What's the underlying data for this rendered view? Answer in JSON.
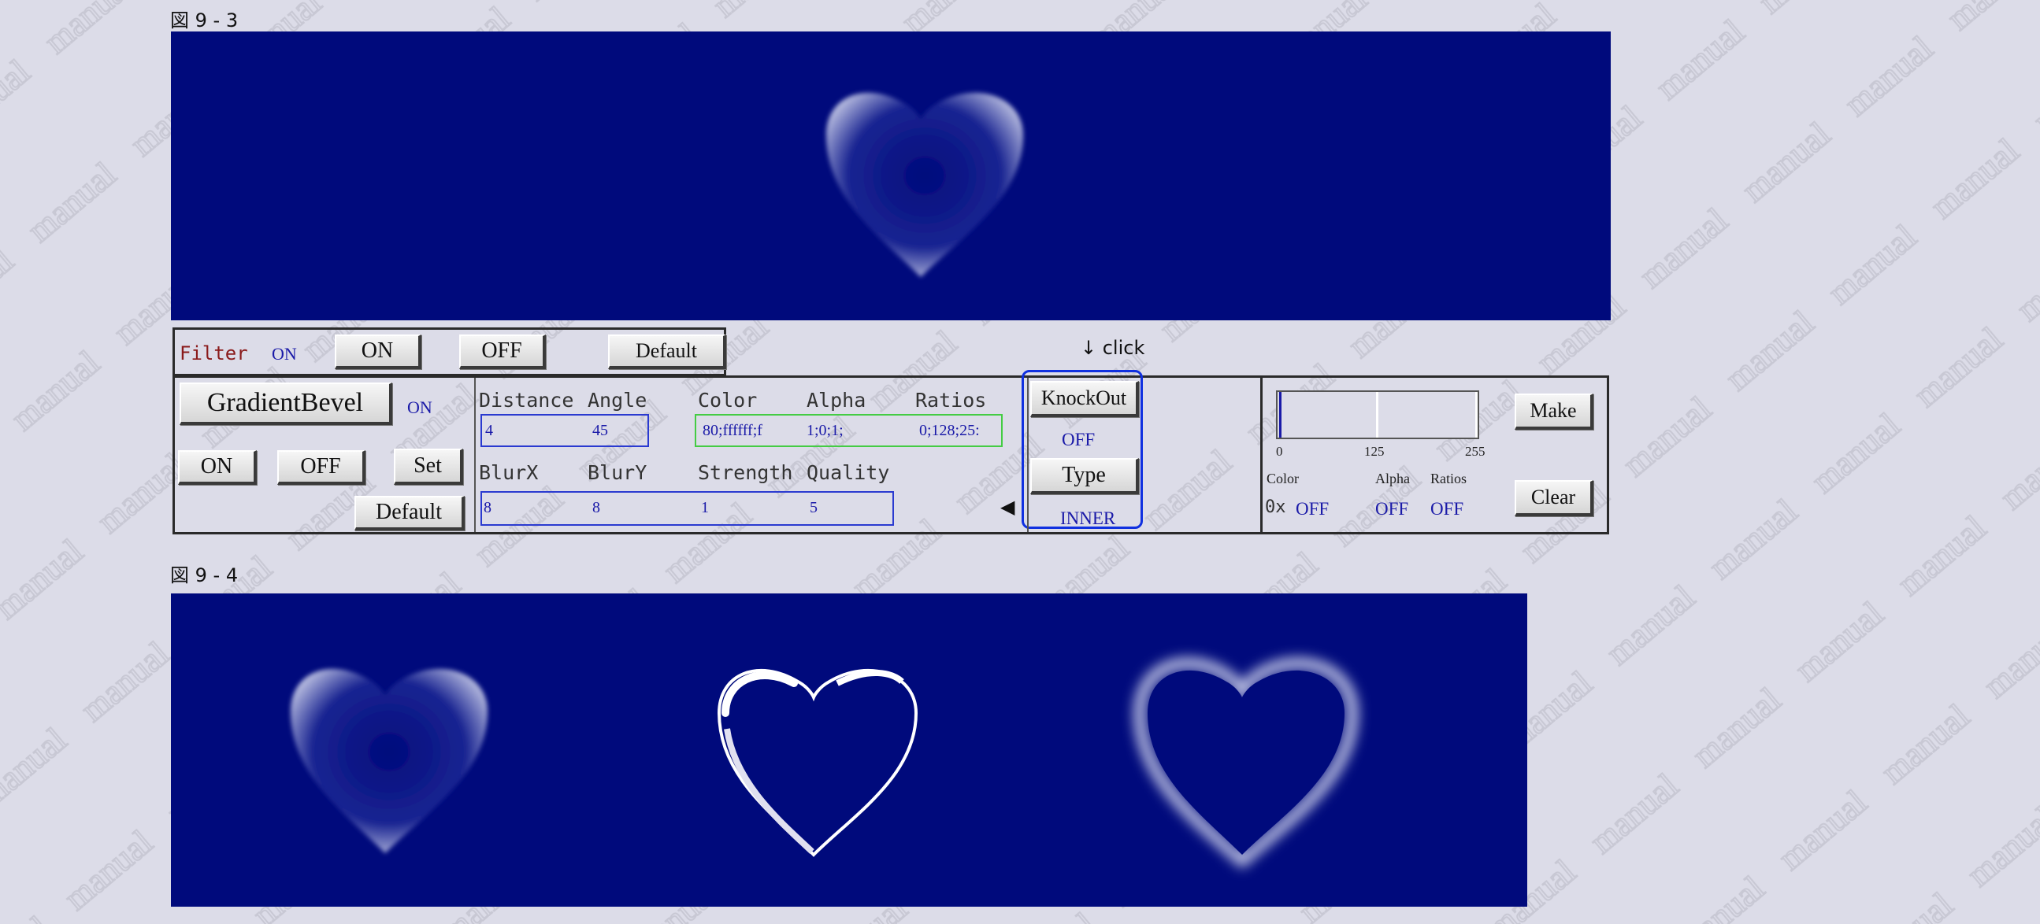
{
  "figures": {
    "fig3_label": "図 9 - 3",
    "fig4_label": "図 9 - 4"
  },
  "watermark": {
    "text": "manual"
  },
  "annotation": {
    "click_text": "↓ click",
    "arrow": "◀"
  },
  "filter_bar": {
    "label": "Filter",
    "status": "ON",
    "on_label": "ON",
    "off_label": "OFF",
    "default_label": "Default"
  },
  "bevel": {
    "name_label": "GradientBevel",
    "status": "ON",
    "on_label": "ON",
    "off_label": "OFF",
    "set_label": "Set",
    "default_label": "Default"
  },
  "params": {
    "distance_label": "Distance",
    "angle_label": "Angle",
    "color_label": "Color",
    "alpha_label": "Alpha",
    "ratios_label": "Ratios",
    "blurx_label": "BlurX",
    "blury_label": "BlurY",
    "strength_label": "Strength",
    "quality_label": "Quality",
    "distance": "4",
    "angle": "45",
    "color": "80;ffffff;f",
    "alpha": "1;0;1;",
    "ratios": "0;128;25:",
    "blurx": "8",
    "blury": "8",
    "strength": "1",
    "quality": "5"
  },
  "knockout": {
    "knockout_label": "KnockOut",
    "knockout_value": "OFF",
    "type_label": "Type",
    "type_value": "INNER"
  },
  "gradient_editor": {
    "tick_0": "0",
    "tick_125": "125",
    "tick_255": "255",
    "color_label": "Color",
    "alpha_label": "Alpha",
    "ratios_label": "Ratios",
    "color_prefix": "0x",
    "color_value": "OFF",
    "alpha_value": "OFF",
    "ratios_value": "OFF",
    "make_label": "Make",
    "clear_label": "Clear"
  },
  "colors": {
    "stage_bg": "#000a7c",
    "page_bg": "#dcdce8",
    "field_blue": "#2a3ad0",
    "field_green": "#44cc44",
    "highlight_blue": "#1030e0"
  }
}
